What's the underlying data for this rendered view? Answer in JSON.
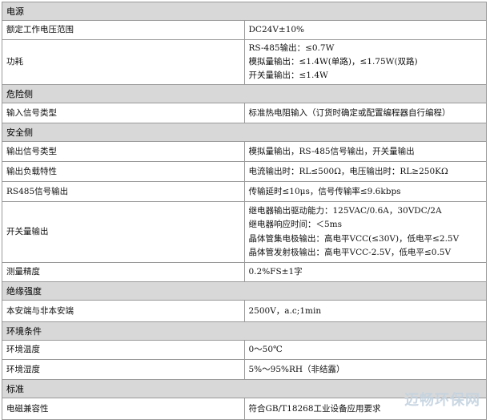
{
  "sections": [
    {
      "title": "电源",
      "rows": [
        {
          "label": "额定工作电压范围",
          "lines": [
            "DC24V±10%"
          ]
        },
        {
          "label": "功耗",
          "lines": [
            "RS-485输出：≤0.7W",
            "模拟量输出：≤1.4W(单路)，≤1.75W(双路)",
            "开关量输出：≤1.4W"
          ]
        }
      ]
    },
    {
      "title": "危险侧",
      "rows": [
        {
          "label": "输入信号类型",
          "lines": [
            "标准热电阻输入（订货时确定或配置编程器自行编程）"
          ]
        }
      ]
    },
    {
      "title": "安全侧",
      "rows": [
        {
          "label": "输出信号类型",
          "lines": [
            "模拟量输出，RS-485信号输出，开关量输出"
          ]
        },
        {
          "label": "输出负载特性",
          "lines": [
            "电流输出时：RL≤500Ω，电压输出时：RL≥250KΩ"
          ]
        },
        {
          "label": "RS485信号输出",
          "lines": [
            "传输延时≤10μs，信号传输率≤9.6kbps"
          ]
        },
        {
          "label": "开关量输出",
          "lines": [
            "继电器输出驱动能力：125VAC/0.6A，30VDC/2A",
            "继电器响应时间：＜5ms",
            "晶体管集电极输出：高电平VCC(≤30V)，低电平≤2.5V",
            "晶体管发射极输出：高电平VCC-2.5V，低电平≤0.5V"
          ]
        },
        {
          "label": "测量精度",
          "lines": [
            "0.2%FS±1字"
          ]
        }
      ]
    },
    {
      "title": "绝缘强度",
      "rows": [
        {
          "label": "本安端与非本安端",
          "lines": [
            "2500V，a.c;1min"
          ]
        }
      ]
    },
    {
      "title": "环境条件",
      "rows": [
        {
          "label": "环境温度",
          "lines": [
            "0～50℃"
          ]
        },
        {
          "label": "环境湿度",
          "lines": [
            "5%～95%RH（非结露）"
          ]
        }
      ]
    },
    {
      "title": "标准",
      "rows": [
        {
          "label": "电磁兼容性",
          "lines": [
            "符合GB/T18268工业设备应用要求"
          ]
        }
      ]
    }
  ],
  "watermark": "迈畅环保网"
}
